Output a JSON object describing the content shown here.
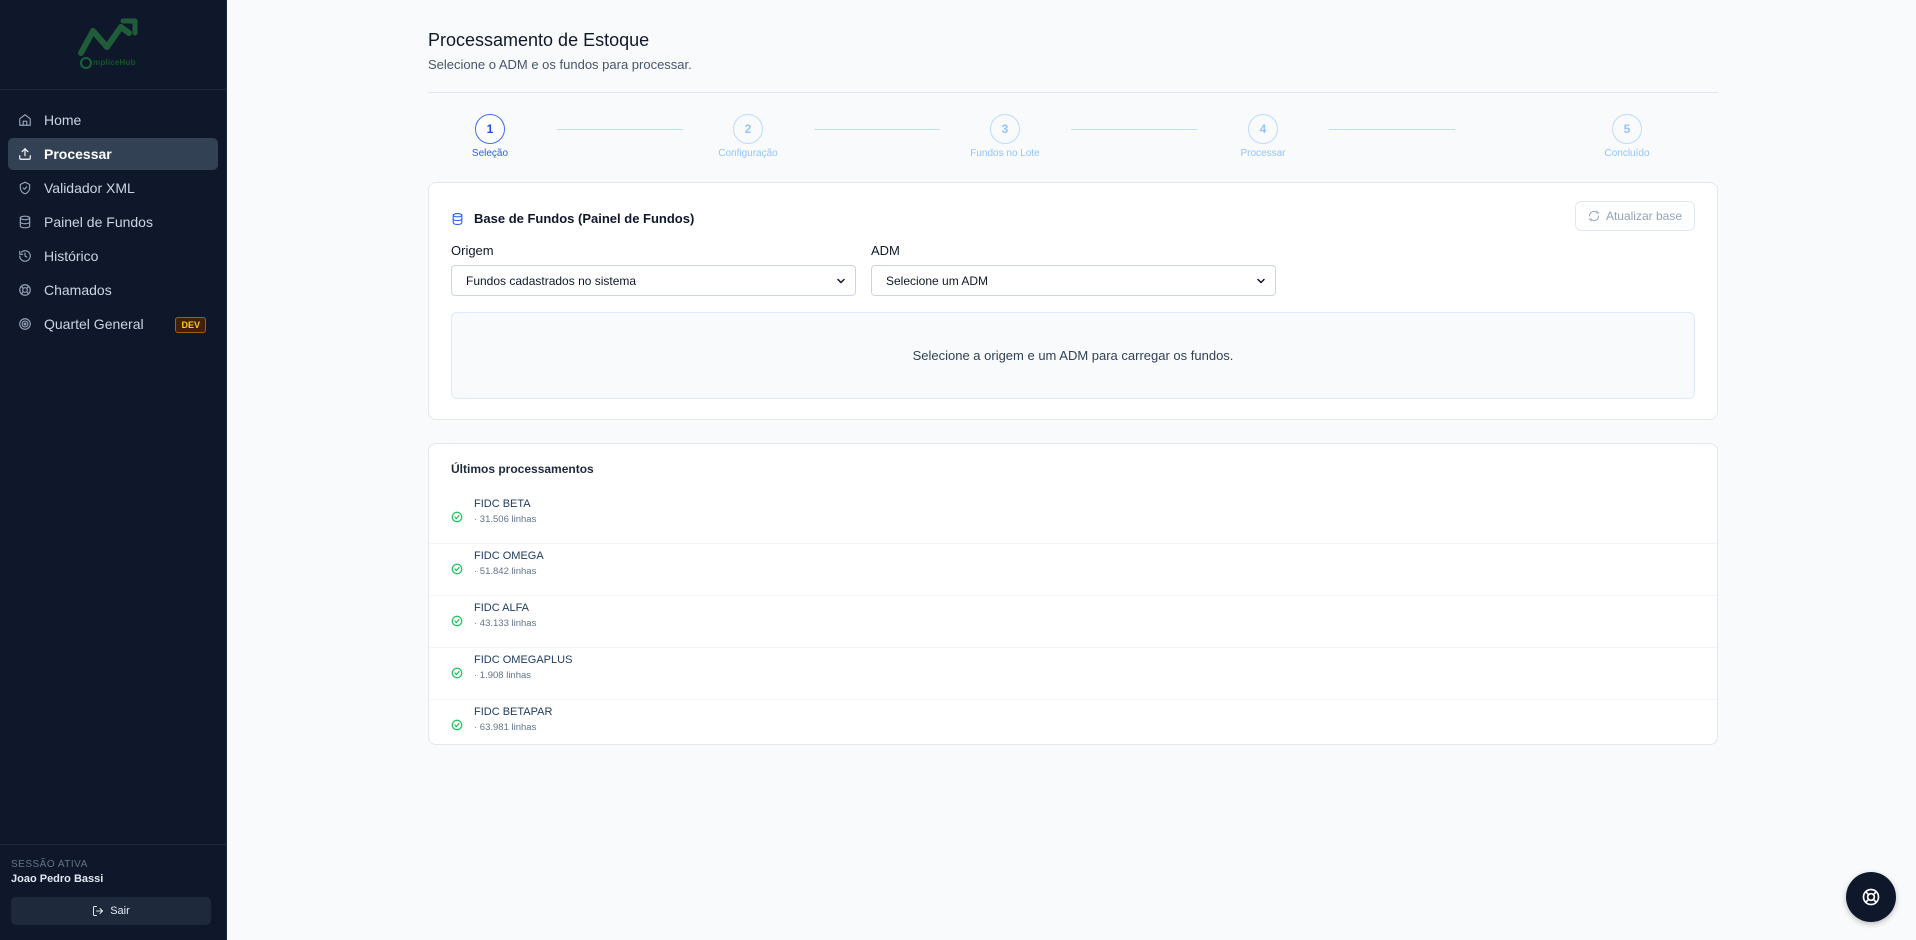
{
  "sidebar": {
    "logo_text": "mpliceHub",
    "items": [
      {
        "label": "Home",
        "icon": "home-icon"
      },
      {
        "label": "Processar",
        "icon": "upload-icon",
        "active": true
      },
      {
        "label": "Validador XML",
        "icon": "shield-check-icon"
      },
      {
        "label": "Painel de Fundos",
        "icon": "database-icon"
      },
      {
        "label": "Histórico",
        "icon": "history-icon"
      },
      {
        "label": "Chamados",
        "icon": "lifebuoy-icon"
      },
      {
        "label": "Quartel General",
        "icon": "target-icon",
        "badge": "DEV"
      }
    ],
    "session_label": "SESSÃO ATIVA",
    "session_user": "Joao Pedro Bassi",
    "logout_label": "Sair"
  },
  "header": {
    "title": "Processamento de Estoque",
    "subtitle": "Selecione o ADM e os fundos para processar."
  },
  "stepper": [
    {
      "number": "1",
      "label": "Seleção",
      "active": true
    },
    {
      "number": "2",
      "label": "Configuração"
    },
    {
      "number": "3",
      "label": "Fundos no Lote"
    },
    {
      "number": "4",
      "label": "Processar"
    },
    {
      "number": "5",
      "label": "Concluído"
    }
  ],
  "base_card": {
    "title": "Base de Fundos (Painel de Fundos)",
    "refresh_label": "Atualizar base",
    "origem_label": "Origem",
    "origem_value": "Fundos cadastrados no sistema",
    "adm_label": "ADM",
    "adm_value": "Selecione um ADM",
    "empty_message": "Selecione a origem e um ADM para carregar os fundos."
  },
  "recent": {
    "title": "Últimos processamentos",
    "items": [
      {
        "name": "FIDC BETA",
        "meta": "· 31.506 linhas"
      },
      {
        "name": "FIDC OMEGA",
        "meta": "· 51.842 linhas"
      },
      {
        "name": "FIDC ALFA",
        "meta": "· 43.133 linhas"
      },
      {
        "name": "FIDC OMEGAPLUS",
        "meta": "· 1.908 linhas"
      },
      {
        "name": "FIDC BETAPAR",
        "meta": "· 63.981 linhas"
      }
    ]
  },
  "colors": {
    "sidebar_bg": "#0f172a",
    "accent": "#2563eb",
    "success": "#22c55e",
    "dev_badge": "#facc15"
  }
}
